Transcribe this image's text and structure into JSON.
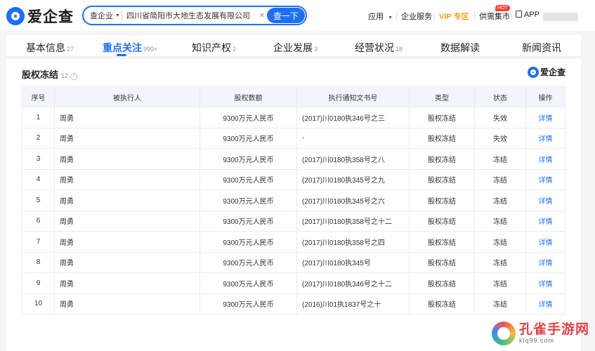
{
  "header": {
    "logo_text": "爱企查",
    "search": {
      "scope": "查企业",
      "value": "四川省简阳市大地生态发展有限公司",
      "button": "查一下"
    },
    "nav": {
      "apps": "应用",
      "services": "企业服务",
      "vip": "VIP 专区",
      "market": "供需集市",
      "hot": "HOT",
      "app": "APP"
    }
  },
  "tabs": [
    {
      "label": "基本信息",
      "count": "27"
    },
    {
      "label": "重点关注",
      "count": "999+"
    },
    {
      "label": "知识产权",
      "count": "2"
    },
    {
      "label": "企业发展",
      "count": "3"
    },
    {
      "label": "经营状况",
      "count": "18"
    },
    {
      "label": "数据解读",
      "count": ""
    },
    {
      "label": "新闻资讯",
      "count": ""
    }
  ],
  "section": {
    "title": "股权冻结",
    "count": "12",
    "help": "?",
    "brand": "爱企查"
  },
  "table": {
    "headers": [
      "序号",
      "被执行人",
      "股权数额",
      "执行通知文书号",
      "类型",
      "状态",
      "操作"
    ],
    "rows": [
      [
        "1",
        "周勇",
        "9300万元人民币",
        "(2017)川0180执346号之三",
        "股权冻结",
        "失效",
        "详情"
      ],
      [
        "2",
        "周勇",
        "9300万元人民币",
        "-",
        "股权冻结",
        "失效",
        "详情"
      ],
      [
        "3",
        "周勇",
        "9300万元人民币",
        "(2017)川0180执358号之八",
        "股权冻结",
        "冻结",
        "详情"
      ],
      [
        "4",
        "周勇",
        "9300万元人民币",
        "(2017)川0180执345号之九",
        "股权冻结",
        "冻结",
        "详情"
      ],
      [
        "5",
        "周勇",
        "9300万元人民币",
        "(2017)川0180执345号之六",
        "股权冻结",
        "冻结",
        "详情"
      ],
      [
        "6",
        "周勇",
        "9300万元人民币",
        "(2017)川0180执358号之十二",
        "股权冻结",
        "冻结",
        "详情"
      ],
      [
        "7",
        "周勇",
        "9300万元人民币",
        "(2017)川0180执358号之四",
        "股权冻结",
        "冻结",
        "详情"
      ],
      [
        "8",
        "周勇",
        "9300万元人民币",
        "(2017)川0180执345号",
        "股权冻结",
        "冻结",
        "详情"
      ],
      [
        "9",
        "周勇",
        "9300万元人民币",
        "(2017)川0180执346号之十二",
        "股权冻结",
        "冻结",
        "详情"
      ],
      [
        "10",
        "周勇",
        "9300万元人民币",
        "(2016)川01执1837号之十",
        "股权冻结",
        "冻结",
        "详情"
      ]
    ]
  },
  "watermark": {
    "title": "孔雀手游网",
    "url": "klq99.com"
  },
  "colors": {
    "accent": "#1f6ff2",
    "vip": "#f0a120",
    "hot": "#ff3b30"
  }
}
